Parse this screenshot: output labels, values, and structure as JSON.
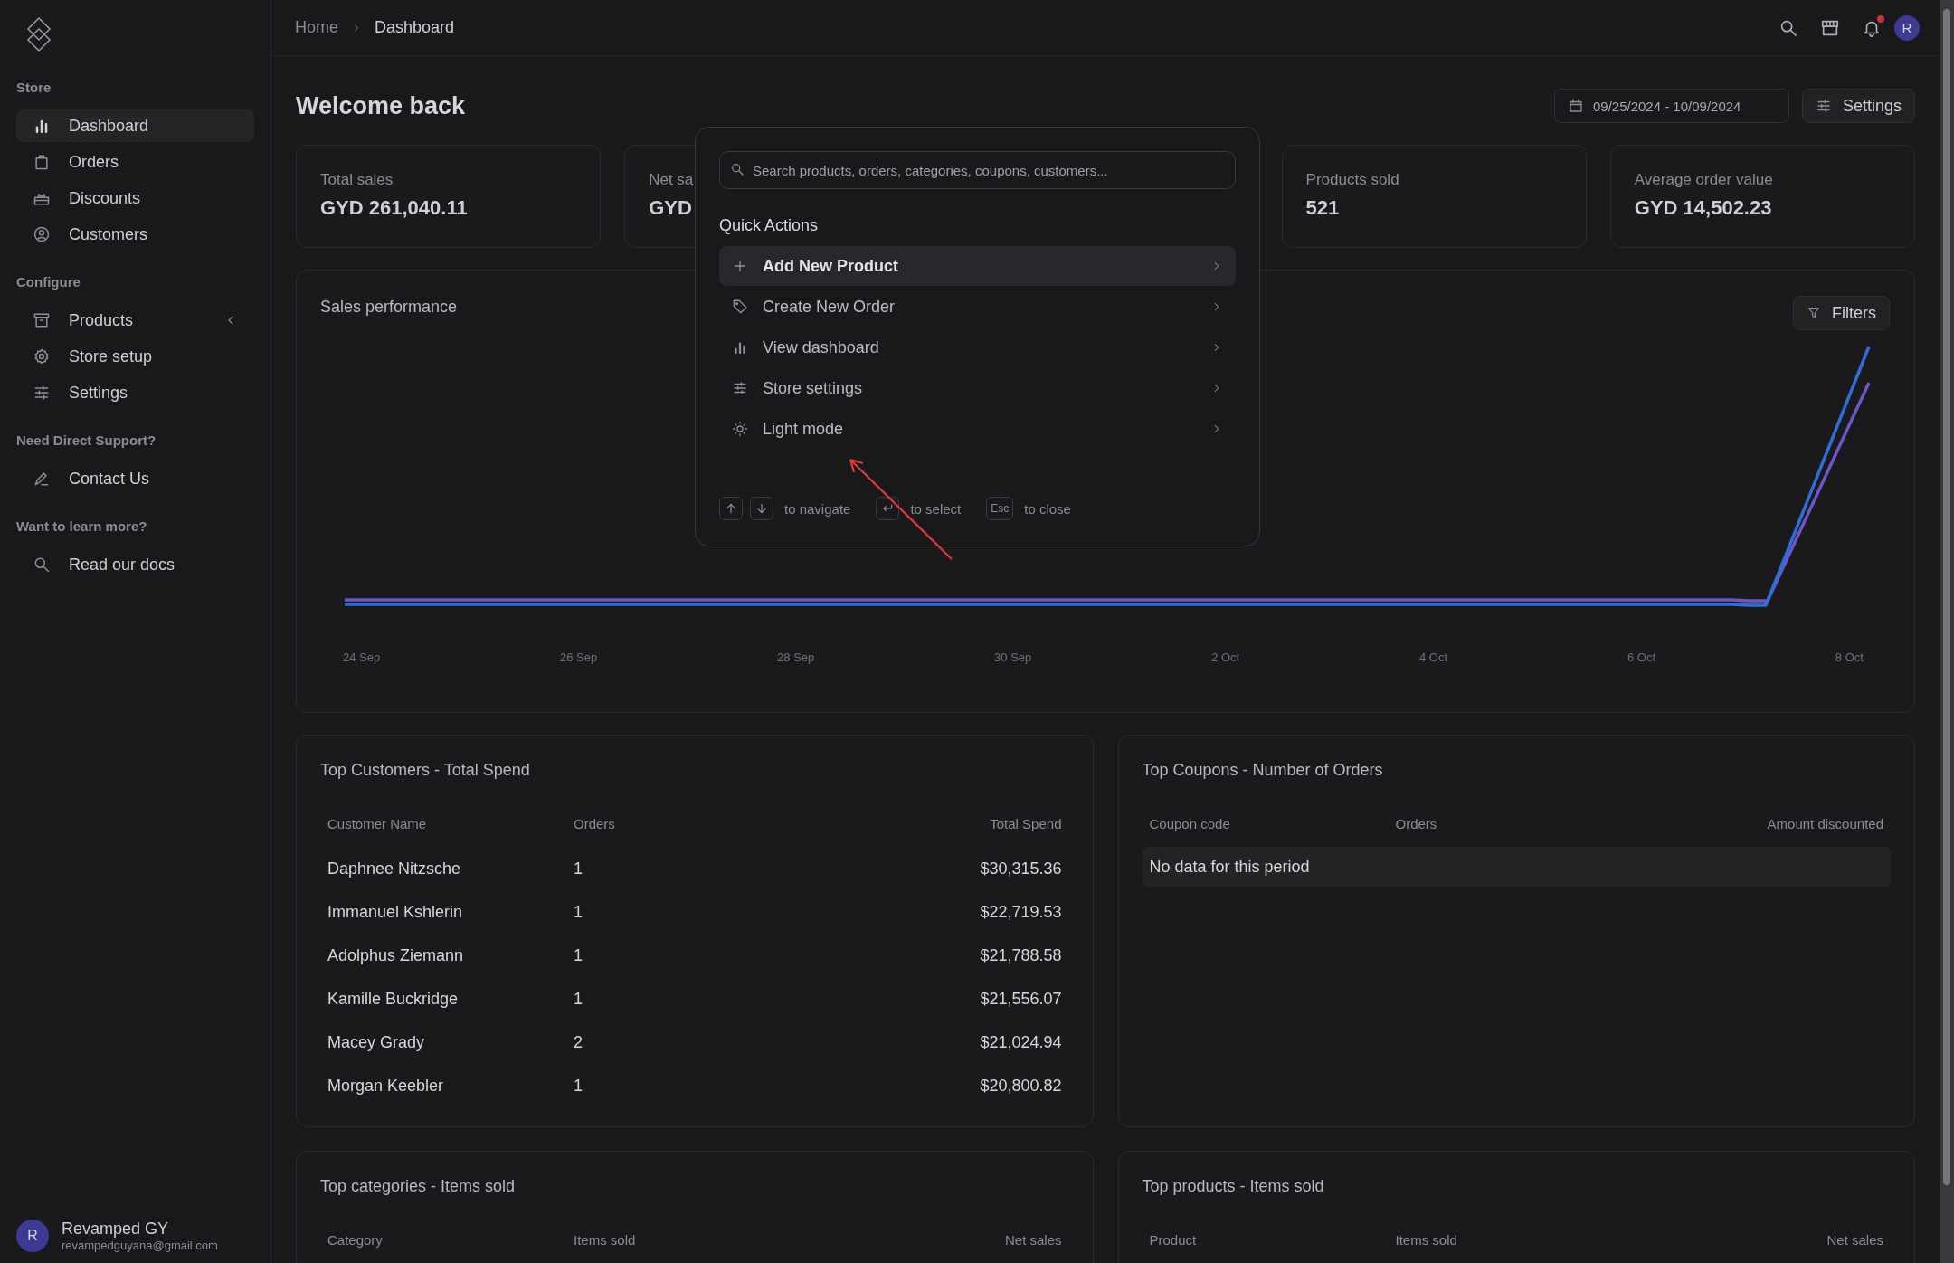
{
  "sidebar": {
    "sections": [
      {
        "title": "Store",
        "items": [
          {
            "label": "Dashboard",
            "selected": true,
            "kind": "link"
          },
          {
            "label": "Orders",
            "selected": false,
            "kind": "link"
          },
          {
            "label": "Discounts",
            "selected": false,
            "kind": "link"
          },
          {
            "label": "Customers",
            "selected": false,
            "kind": "link"
          }
        ]
      },
      {
        "title": "Configure",
        "items": [
          {
            "label": "Products",
            "selected": false,
            "kind": "group"
          },
          {
            "label": "Store setup",
            "selected": false,
            "kind": "link"
          },
          {
            "label": "Settings",
            "selected": false,
            "kind": "link"
          }
        ]
      },
      {
        "title": "Need Direct Support?",
        "items": [
          {
            "label": "Contact Us",
            "selected": false,
            "kind": "link"
          }
        ]
      },
      {
        "title": "Want to learn more?",
        "items": [
          {
            "label": "Read our docs",
            "selected": false,
            "kind": "link"
          }
        ]
      }
    ],
    "user": {
      "initial": "R",
      "name": "Revamped GY",
      "email": "revampedguyana@gmail.com"
    }
  },
  "header": {
    "breadcrumb": [
      "Home",
      "Dashboard"
    ],
    "avatar": "R",
    "notification": true
  },
  "page": {
    "title": "Welcome back",
    "date_range": "09/25/2024 - 10/09/2024",
    "settings_button": "Settings"
  },
  "stats": [
    {
      "label": "Total sales",
      "value": "GYD 261,040.11"
    },
    {
      "label": "Net sa",
      "value": "GYD"
    },
    {
      "label": "Products sold",
      "value": "521"
    },
    {
      "label": "Average order value",
      "value": "GYD 14,502.23"
    }
  ],
  "chart": {
    "title": "Sales performance",
    "filters_button": "Filters",
    "x_labels": [
      "24 Sep",
      "26 Sep",
      "28 Sep",
      "30 Sep",
      "2 Oct",
      "4 Oct",
      "6 Oct",
      "8 Oct"
    ]
  },
  "tables": [
    {
      "title": "Top Customers - Total Spend",
      "columns": [
        "Customer Name",
        "Orders",
        "Total Spend"
      ],
      "rows": [
        [
          "Daphnee Nitzsche",
          "1",
          "$30,315.36"
        ],
        [
          "Immanuel Kshlerin",
          "1",
          "$22,719.53"
        ],
        [
          "Adolphus Ziemann",
          "1",
          "$21,788.58"
        ],
        [
          "Kamille Buckridge",
          "1",
          "$21,556.07"
        ],
        [
          "Macey Grady",
          "2",
          "$21,024.94"
        ],
        [
          "Morgan Keebler",
          "1",
          "$20,800.82"
        ]
      ]
    },
    {
      "title": "Top Coupons - Number of Orders",
      "columns": [
        "Coupon code",
        "Orders",
        "Amount discounted"
      ],
      "empty": "No data for this period"
    },
    {
      "title": "Top categories - Items sold",
      "columns": [
        "Category",
        "Items sold",
        "Net sales"
      ]
    },
    {
      "title": "Top products - Items sold",
      "columns": [
        "Product",
        "Items sold",
        "Net sales"
      ]
    }
  ],
  "command_palette": {
    "placeholder": "Search products, orders, categories, coupons, customers...",
    "group": "Quick Actions",
    "actions": [
      {
        "label": "Add New Product",
        "selected": true
      },
      {
        "label": "Create New Order",
        "selected": false
      },
      {
        "label": "View dashboard",
        "selected": false
      },
      {
        "label": "Store settings",
        "selected": false
      },
      {
        "label": "Light mode",
        "selected": false
      }
    ],
    "hints": [
      {
        "kind": "arrows",
        "label": "to navigate"
      },
      {
        "kind": "enter",
        "label": "to select"
      },
      {
        "kind": "text",
        "key": "Esc",
        "label": "to close"
      }
    ]
  }
}
